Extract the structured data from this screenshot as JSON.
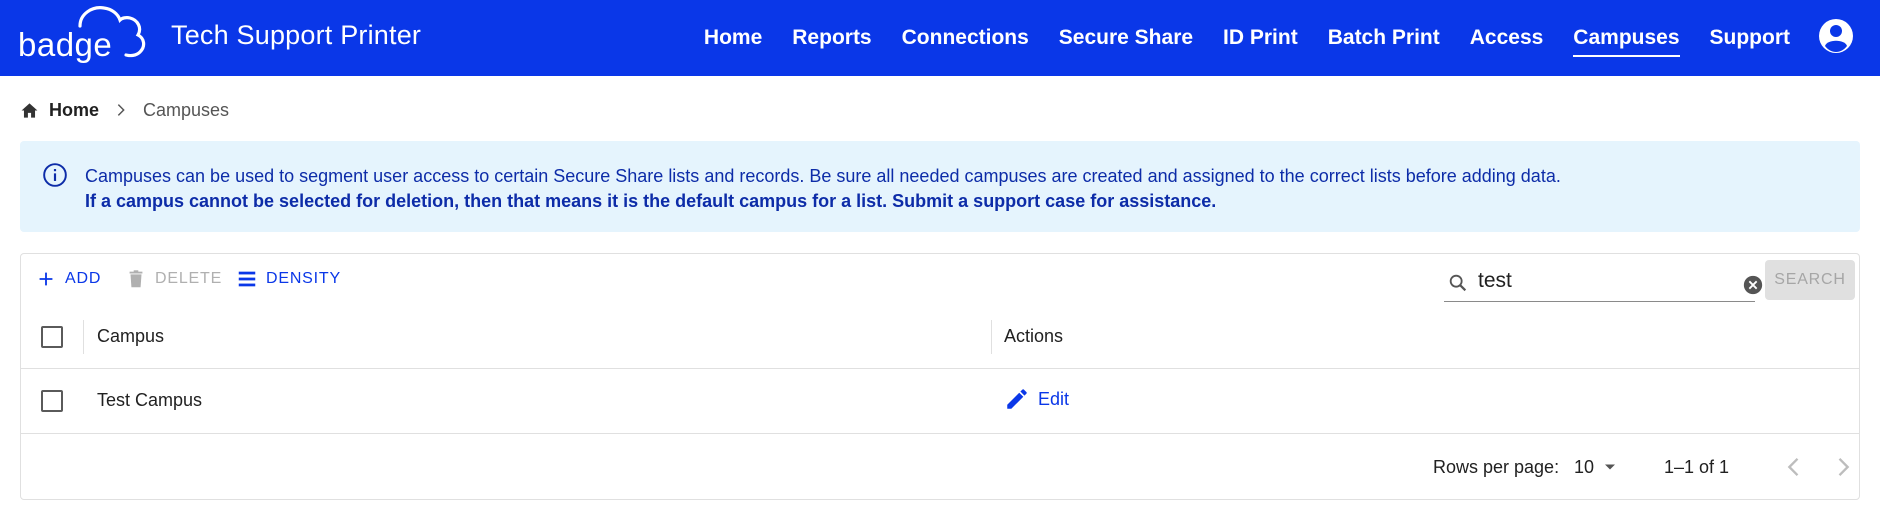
{
  "header": {
    "logo_text": "badge",
    "app_title": "Tech Support Printer",
    "nav": [
      {
        "label": "Home",
        "active": false
      },
      {
        "label": "Reports",
        "active": false
      },
      {
        "label": "Connections",
        "active": false
      },
      {
        "label": "Secure Share",
        "active": false
      },
      {
        "label": "ID Print",
        "active": false
      },
      {
        "label": "Batch Print",
        "active": false
      },
      {
        "label": "Access",
        "active": false
      },
      {
        "label": "Campuses",
        "active": true
      },
      {
        "label": "Support",
        "active": false
      }
    ],
    "account_icon": "account-circle-icon"
  },
  "breadcrumb": {
    "home_label": "Home",
    "current_label": "Campuses"
  },
  "alert": {
    "icon": "info-icon",
    "line1": "Campuses can be used to segment user access to certain Secure Share lists and records. Be sure all needed campuses are created and assigned to the correct lists before adding data.",
    "line2": "If a campus cannot be selected for deletion, then that means it is the default campus for a list. Submit a support case for assistance."
  },
  "toolbar": {
    "add_label": "ADD",
    "delete_label": "DELETE",
    "density_label": "DENSITY",
    "search_value": "test",
    "search_button_label": "SEARCH"
  },
  "grid": {
    "columns": [
      "Campus",
      "Actions"
    ],
    "rows": [
      {
        "campus": "Test Campus",
        "action_label": "Edit",
        "selected": false
      }
    ]
  },
  "footer": {
    "rows_per_page_label": "Rows per page:",
    "rows_per_page_value": "10",
    "range_text": "1–1 of 1"
  },
  "colors": {
    "brand": "#0a37e8",
    "alert_bg": "#e5f4fd",
    "alert_text": "#0d2ca8"
  }
}
